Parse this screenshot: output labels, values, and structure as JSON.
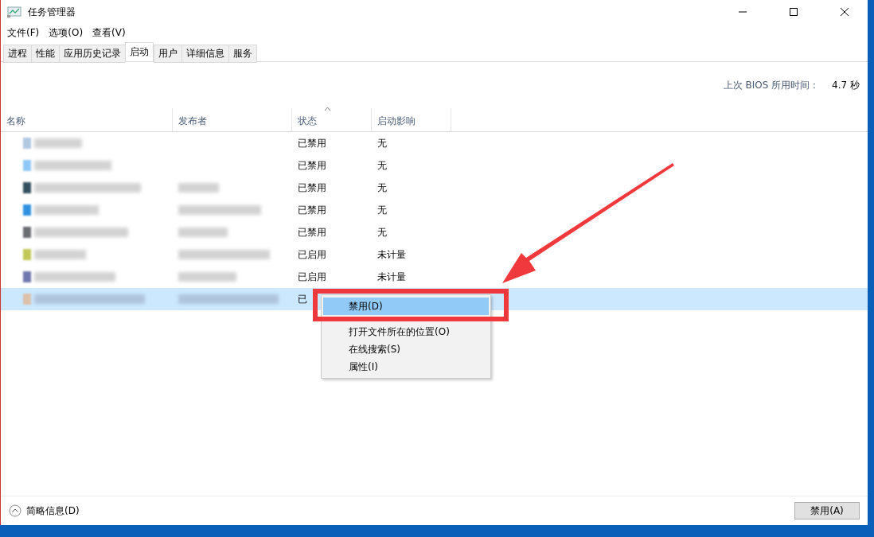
{
  "window": {
    "title": "任务管理器"
  },
  "menu_bar": [
    "文件(F)",
    "选项(O)",
    "查看(V)"
  ],
  "tabs": [
    {
      "label": "进程",
      "selected": false
    },
    {
      "label": "性能",
      "selected": false
    },
    {
      "label": "应用历史记录",
      "selected": false
    },
    {
      "label": "启动",
      "selected": true
    },
    {
      "label": "用户",
      "selected": false
    },
    {
      "label": "详细信息",
      "selected": false
    },
    {
      "label": "服务",
      "selected": false
    }
  ],
  "bios_time": {
    "label": "上次 BIOS 所用时间：",
    "value": "4.7 秒"
  },
  "table": {
    "columns": [
      {
        "label": "名称",
        "sorted": false
      },
      {
        "label": "发布者",
        "sorted": false
      },
      {
        "label": "状态",
        "sorted": true
      },
      {
        "label": "启动影响",
        "sorted": false
      }
    ],
    "rows": [
      {
        "color": "#b0c8e0",
        "publisher_redacted": false,
        "status": "已禁用",
        "impact": "无",
        "selected": false
      },
      {
        "color": "#8ec8f8",
        "publisher_redacted": false,
        "status": "已禁用",
        "impact": "无",
        "selected": false
      },
      {
        "color": "#34505e",
        "publisher_redacted": true,
        "status": "已禁用",
        "impact": "无",
        "selected": false
      },
      {
        "color": "#3090e0",
        "publisher_redacted": true,
        "status": "已禁用",
        "impact": "无",
        "selected": false
      },
      {
        "color": "#6a6e72",
        "publisher_redacted": true,
        "status": "已禁用",
        "impact": "无",
        "selected": false
      },
      {
        "color": "#c0c858",
        "publisher_redacted": true,
        "status": "已启用",
        "impact": "未计量",
        "selected": false
      },
      {
        "color": "#7078b0",
        "publisher_redacted": true,
        "status": "已启用",
        "impact": "未计量",
        "selected": false
      },
      {
        "color": "#dcc0a8",
        "publisher_redacted": true,
        "status": "已",
        "selected": true
      }
    ]
  },
  "context_menu": {
    "items": [
      {
        "label": "禁用(D)",
        "selected": true
      },
      {
        "label": "打开文件所在的位置(O)",
        "selected": false
      },
      {
        "label": "在线搜索(S)",
        "selected": false
      },
      {
        "label": "属性(I)",
        "selected": false
      }
    ]
  },
  "footer": {
    "details_toggle": "简略信息(D)",
    "button": "禁用(A)"
  }
}
